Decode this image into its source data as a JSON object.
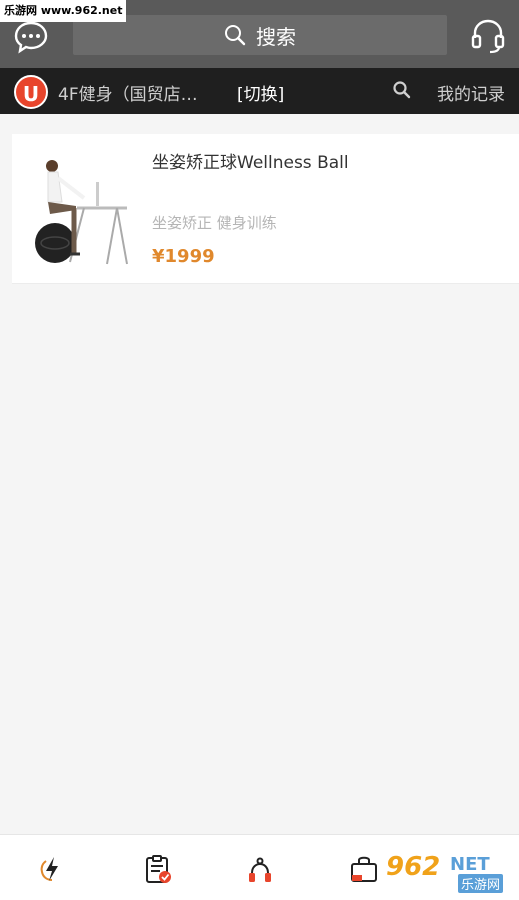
{
  "watermark_top": "乐游网 www.962.net",
  "header": {
    "search_label": "搜索",
    "chat_icon": "chat-bubble-icon",
    "support_icon": "headset-icon"
  },
  "store_bar": {
    "logo_letter": "U",
    "store_name": "4F健身（国贸店…",
    "switch_label": "[切换]",
    "records_label": "我的记录"
  },
  "products": [
    {
      "title": "坐姿矫正球Wellness Ball",
      "tags": "坐姿矫正 健身训练",
      "price": "¥1999"
    }
  ],
  "bottom_nav": [
    {
      "icon": "lightning-icon"
    },
    {
      "icon": "clipboard-check-icon"
    },
    {
      "icon": "jump-rope-icon"
    },
    {
      "icon": "shopping-bag-icon"
    }
  ],
  "watermark_logo": {
    "number": "962",
    "net": "NET",
    "cn": "乐游网"
  },
  "colors": {
    "header_bg": "#5a5a5a",
    "store_bar_bg": "#1f1f1f",
    "logo_red": "#e8452c",
    "price_orange": "#e0882c"
  }
}
